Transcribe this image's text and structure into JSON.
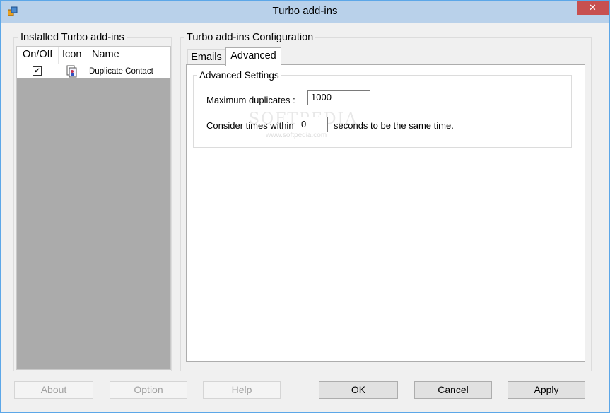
{
  "window": {
    "title": "Turbo add-ins",
    "close_glyph": "✕"
  },
  "installed": {
    "group_title": "Installed Turbo add-ins",
    "columns": [
      "On/Off",
      "Icon",
      "Name"
    ],
    "rows": [
      {
        "enabled": true,
        "check_glyph": "✔",
        "icon": "contact-addin-icon",
        "name": "Duplicate Contact"
      }
    ]
  },
  "config": {
    "group_title": "Turbo add-ins Configuration",
    "tabs": [
      {
        "label": "Emails",
        "active": false
      },
      {
        "label": "Advanced",
        "active": true
      }
    ],
    "advanced": {
      "group_title": "Advanced Settings",
      "max_duplicates_label": "Maximum duplicates :",
      "max_duplicates_value": "1000",
      "consider_label": "Consider times within",
      "consider_value": "0",
      "consider_suffix": "seconds to be the same time."
    }
  },
  "watermark": {
    "main": "SOFTPEDIA",
    "sub": "www.softpedia.com"
  },
  "buttons": {
    "about": "About",
    "option": "Option",
    "help": "Help",
    "ok": "OK",
    "cancel": "Cancel",
    "apply": "Apply"
  },
  "colors": {
    "titlebar": "#b9d1ea",
    "close_button": "#c75050",
    "list_background": "#ababab"
  }
}
